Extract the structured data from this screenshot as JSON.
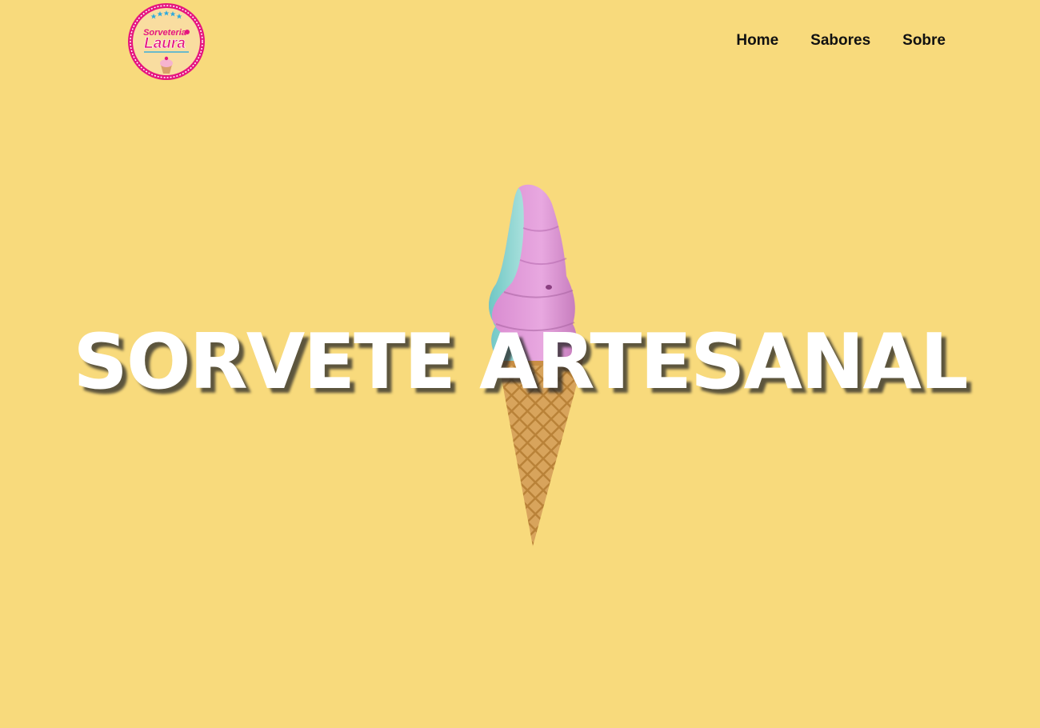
{
  "brand": {
    "logo_text_top": "Sorveteria",
    "logo_text_main": "Laura",
    "icon": "ice-cream-shop-logo"
  },
  "nav": {
    "items": [
      {
        "label": "Home"
      },
      {
        "label": "Sabores"
      },
      {
        "label": "Sobre"
      }
    ]
  },
  "hero": {
    "title": "SORVETE ARTESANAL",
    "image": "soft-serve-ice-cream-cone"
  },
  "colors": {
    "background": "#f8da7c",
    "nav_text": "#111111",
    "title": "#ffffff",
    "logo_pink": "#e5157f",
    "logo_blue": "#2ea9dd"
  }
}
